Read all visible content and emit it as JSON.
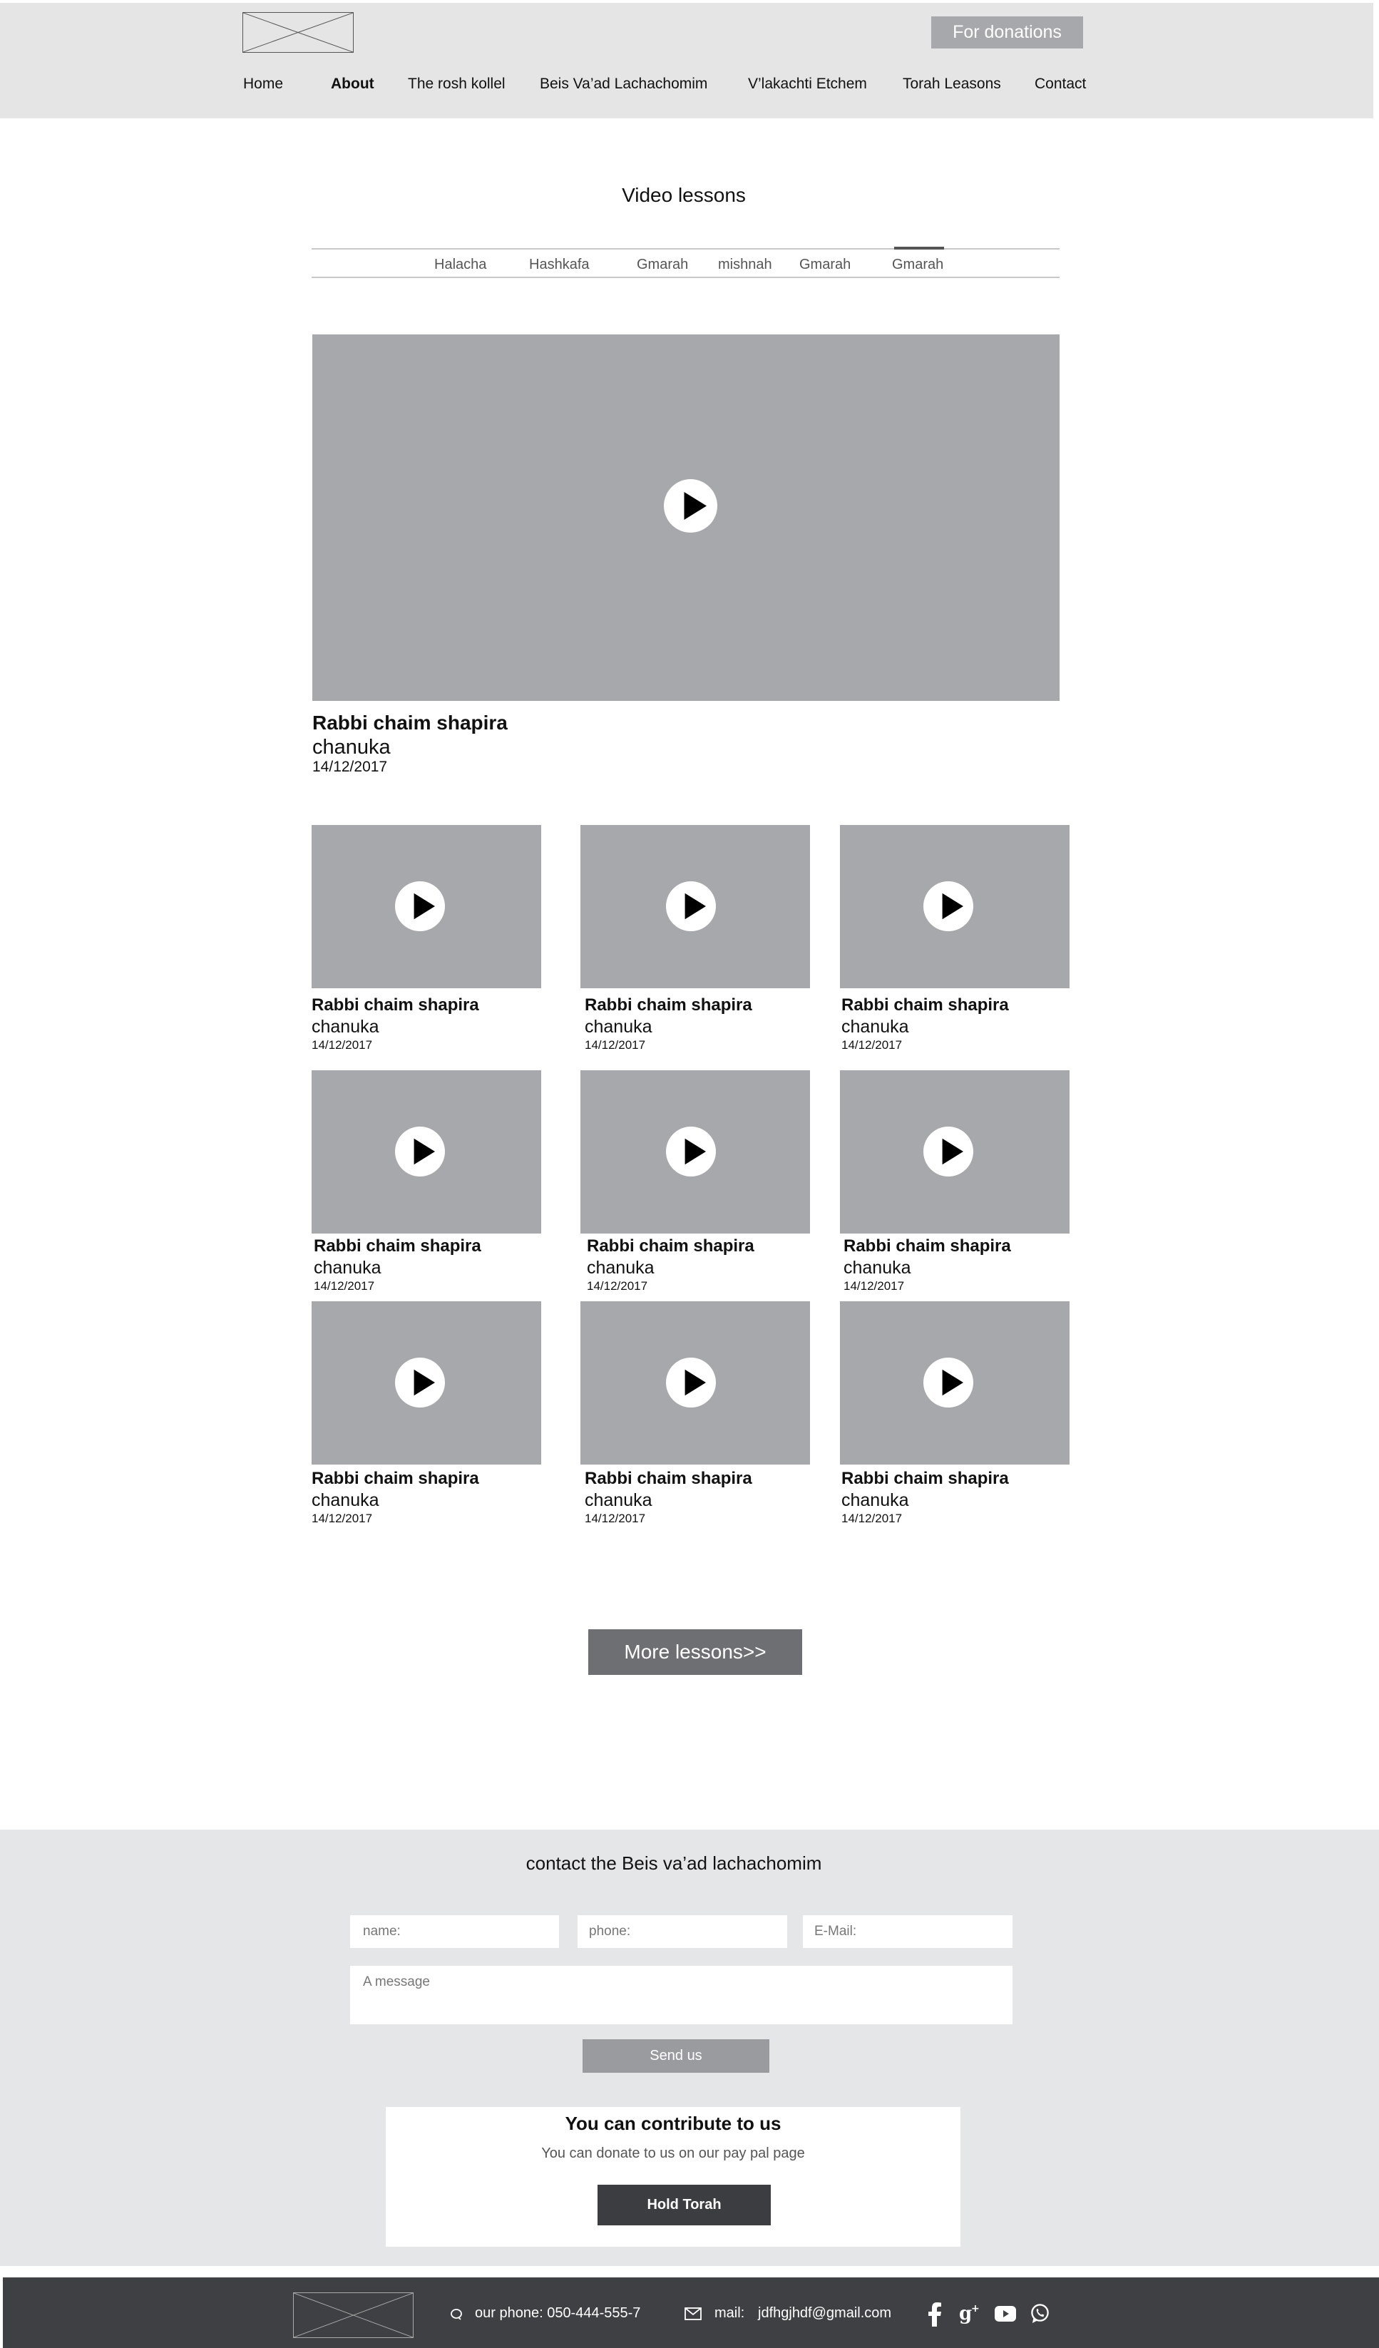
{
  "header": {
    "logo_alt": "logo",
    "donate_label": "For donations",
    "nav": [
      {
        "label": "Home"
      },
      {
        "label": "About"
      },
      {
        "label": "The rosh kollel"
      },
      {
        "label": "Beis Va’ad Lachachomim"
      },
      {
        "label": "V’lakachti Etchem"
      },
      {
        "label": "Torah Leasons"
      },
      {
        "label": "Contact"
      }
    ],
    "active_nav": "About"
  },
  "lessons": {
    "title": "Video lessons",
    "tabs": [
      {
        "label": "Halacha"
      },
      {
        "label": "Hashkafa"
      },
      {
        "label": "Gmarah"
      },
      {
        "label": "mishnah"
      },
      {
        "label": "Gmarah"
      },
      {
        "label": "Gmarah"
      }
    ],
    "active_tab_index": 5,
    "featured": {
      "name": "Rabbi chaim shapira",
      "topic": "chanuka",
      "date": "14/12/2017"
    },
    "videos": [
      {
        "name": "Rabbi chaim shapira",
        "topic": "chanuka",
        "date": "14/12/2017"
      },
      {
        "name": "Rabbi chaim shapira",
        "topic": "chanuka",
        "date": "14/12/2017"
      },
      {
        "name": "Rabbi chaim shapira",
        "topic": "chanuka",
        "date": "14/12/2017"
      },
      {
        "name": "Rabbi chaim shapira",
        "topic": "chanuka",
        "date": "14/12/2017"
      },
      {
        "name": "Rabbi chaim shapira",
        "topic": "chanuka",
        "date": "14/12/2017"
      },
      {
        "name": "Rabbi chaim shapira",
        "topic": "chanuka",
        "date": "14/12/2017"
      },
      {
        "name": "Rabbi chaim shapira",
        "topic": "chanuka",
        "date": "14/12/2017"
      },
      {
        "name": "Rabbi chaim shapira",
        "topic": "chanuka",
        "date": "14/12/2017"
      },
      {
        "name": "Rabbi chaim shapira",
        "topic": "chanuka",
        "date": "14/12/2017"
      }
    ],
    "more_label": "More lessons>>"
  },
  "contact": {
    "title": "contact the Beis va’ad lachachomim",
    "name_placeholder": "name:",
    "phone_placeholder": "phone:",
    "email_placeholder": "E-Mail:",
    "message_placeholder": "A message",
    "send_label": "Send us",
    "contribute_title": "You can contribute to us",
    "contribute_text": "You can donate to us on our pay pal page",
    "contribute_button": "Hold Torah"
  },
  "footer": {
    "phone_text": "our phone: 050-444-555-7",
    "mail_label": "mail:",
    "mail_value": "jdfhgjhdf@gmail.com",
    "social_icons": [
      "facebook-icon",
      "google-plus-icon",
      "youtube-icon",
      "whatsapp-icon"
    ]
  },
  "colors": {
    "header_bg": "#e5e5e5",
    "placeholder_gray": "#a7a8ab",
    "footer_bg": "#3f4043",
    "dark_button": "#3c3d40"
  }
}
